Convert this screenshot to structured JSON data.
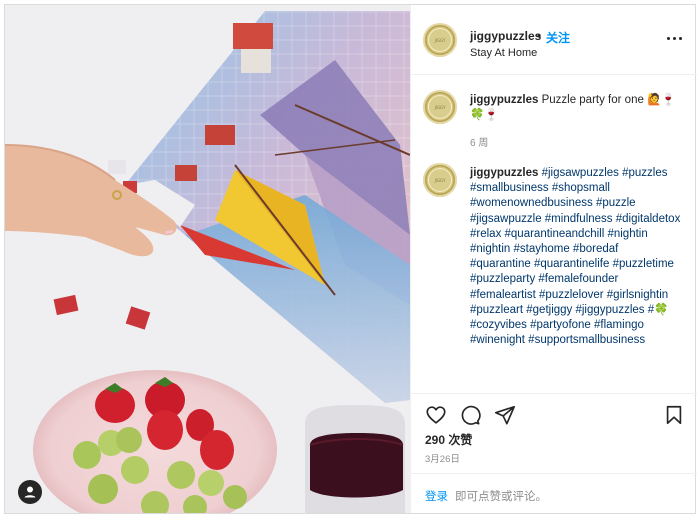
{
  "post": {
    "username": "jiggypuzzles",
    "dot": "•",
    "follow_label": "关注",
    "location": "Stay At Home",
    "avatar_text": "JIGGY"
  },
  "caption": {
    "username": "jiggypuzzles",
    "text": "Puzzle party for one 🙋🍷🍀🍷",
    "time_ago": "6 周"
  },
  "hashtag_comment": {
    "username": "jiggypuzzles",
    "tags": "#jigsawpuzzles #puzzles #smallbusiness #shopsmall #womenownedbusiness #puzzle #jigsawpuzzle #mindfulness #digitaldetox #relax #quarantineandchill #nightin #nightin #stayhome #boredaf #quarantine #quarantinelife #puzzletime #puzzleparty #femalefounder #femaleartist #puzzlelover #girlsnightin #puzzleart #getjiggy #jiggypuzzles #🍀 #cozyvibes #partyofone #flamingo #winenight #supportsmallbusiness"
  },
  "engagement": {
    "likes": "290 次赞",
    "date": "3月26日"
  },
  "footer": {
    "login_label": "登录",
    "login_suffix": "即可点赞或评论。"
  },
  "icons": {
    "like": "heart-icon",
    "comment": "comment-bubble-icon",
    "share": "paper-plane-icon",
    "save": "bookmark-icon",
    "more": "more-options-icon",
    "tags": "user-tag-icon"
  },
  "colors": {
    "accent_blue": "#0095f6",
    "hashtag_blue": "#00376b",
    "text": "#262626",
    "muted": "#8e8e8e",
    "border": "#dbdbdb"
  }
}
